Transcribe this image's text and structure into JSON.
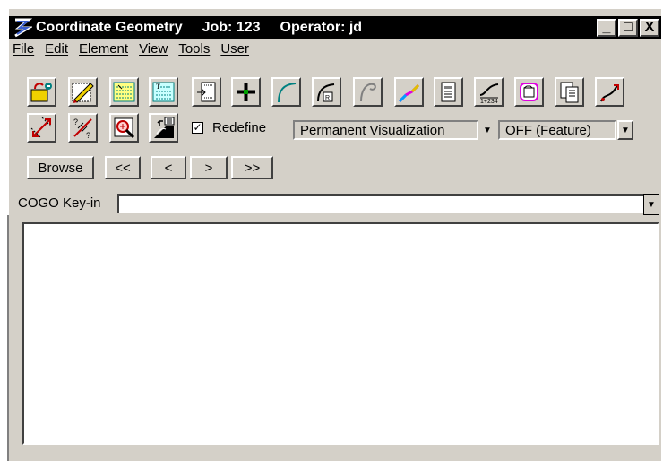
{
  "window": {
    "title": "Coordinate Geometry",
    "job": "Job: 123",
    "operator": "Operator: jd",
    "minimize": "_",
    "maximize": "□",
    "close": "X"
  },
  "menu": [
    "File",
    "Edit",
    "Element",
    "View",
    "Tools",
    "User"
  ],
  "toolbar": {
    "row1_icons": [
      "open-folder-icon",
      "edit-pencil-icon",
      "list-text-icon",
      "text-list-icon",
      "insert-page-icon",
      "point-cross-icon",
      "curve-icon",
      "radius-curve-icon",
      "spiral-icon",
      "alignment-icon",
      "document-edit-icon",
      "profile-station-icon",
      "region-icon",
      "copy-pages-icon",
      "path-arrow-icon"
    ],
    "row2_icons": [
      "measure-icon",
      "angle-icon",
      "zoom-search-icon",
      "layer-up-icon"
    ],
    "redefine": {
      "label": "Redefine",
      "checked": true,
      "mark": "✓"
    },
    "visualization": {
      "value": "Permanent Visualization",
      "arrow": "▼"
    },
    "feature": {
      "value": "OFF (Feature)",
      "arrow": "▼"
    }
  },
  "nav": {
    "browse": "Browse",
    "first": "<<",
    "prev": "<",
    "next": ">",
    "last": ">>"
  },
  "keyin": {
    "label": "COGO Key-in",
    "value": "",
    "arrow": "▼"
  },
  "output": {
    "text": ""
  }
}
